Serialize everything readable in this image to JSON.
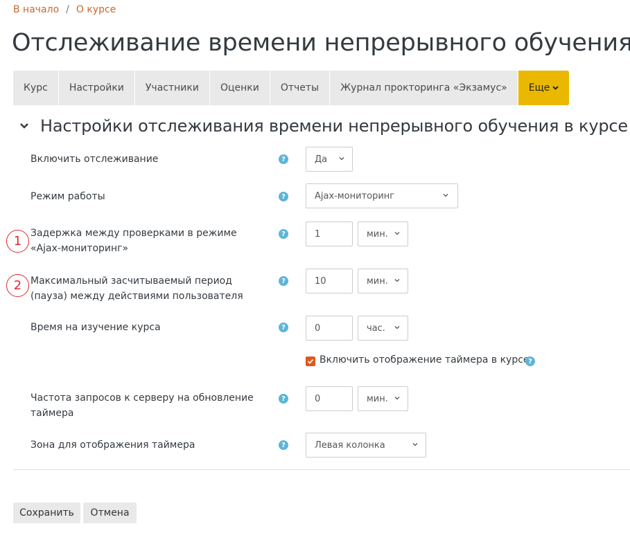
{
  "breadcrumb": {
    "home": "В начало",
    "separator": "/",
    "course": "О курсе"
  },
  "page_title": "Отслеживание времени непрерывного обучения",
  "tabs": [
    "Курс",
    "Настройки",
    "Участники",
    "Оценки",
    "Отчеты",
    "Журнал прокторинга «Экзамус»"
  ],
  "more_tab": "Еще",
  "section_title": "Настройки отслеживания времени непрерывного обучения в курсе",
  "help_glyph": "?",
  "fields": {
    "enable": {
      "label": "Включить отслеживание",
      "value": "Да"
    },
    "mode": {
      "label": "Режим работы",
      "value": "Ajax-мониторинг"
    },
    "delay": {
      "label": "Задержка между проверками в режиме «Ajax-мониторинг»",
      "value": "1",
      "unit": "мин.",
      "marker": "1"
    },
    "max_period": {
      "label": "Максимальный засчитываемый период (пауза) между действиями пользователя",
      "value": "10",
      "unit": "мин.",
      "marker": "2"
    },
    "study_time": {
      "label": "Время на изучение курса",
      "value": "0",
      "unit": "час."
    },
    "timer_checkbox": {
      "label": "Включить отображение таймера в курсе",
      "checked": true
    },
    "request_freq": {
      "label": "Частота запросов к серверу на обновление таймера",
      "value": "0",
      "unit": "мин."
    },
    "timer_zone": {
      "label": "Зона для отображения таймера",
      "value": "Левая колонка"
    }
  },
  "buttons": {
    "save": "Сохранить",
    "cancel": "Отмена"
  },
  "colors": {
    "link": "#c8682a",
    "more_tab": "#eab800",
    "help": "#5db5d8",
    "checkbox": "#e3571c",
    "marker": "#e0282b"
  }
}
